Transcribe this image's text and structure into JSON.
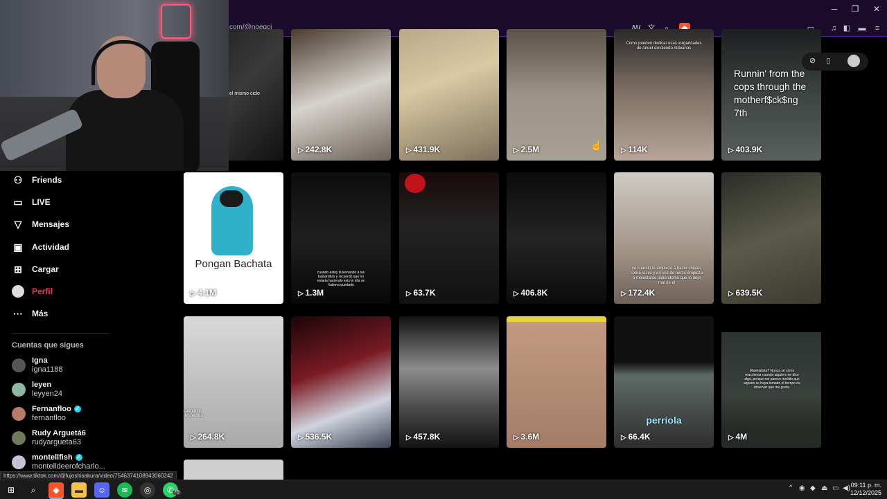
{
  "browser": {
    "url": "com/@noegcj",
    "status_url": "https://www.tiktok.com/@fujoshisakura/video/7546374108943060242"
  },
  "sidebar": {
    "items": [
      {
        "label": "Friends",
        "icon": "friends-icon"
      },
      {
        "label": "LIVE",
        "icon": "live-icon"
      },
      {
        "label": "Mensajes",
        "icon": "messages-icon"
      },
      {
        "label": "Actividad",
        "icon": "activity-icon"
      },
      {
        "label": "Cargar",
        "icon": "upload-icon"
      },
      {
        "label": "Perfil",
        "icon": "profile-avatar"
      },
      {
        "label": "Más",
        "icon": "more-icon"
      }
    ],
    "following_header": "Cuentas que sigues",
    "following": [
      {
        "name": "Igna",
        "user": "igna1188",
        "verified": false
      },
      {
        "name": "leyen",
        "user": "leyyen24",
        "verified": false
      },
      {
        "name": "Fernanfloo",
        "user": "fernanfloo",
        "verified": true
      },
      {
        "name": "Rudy Arguetá6",
        "user": "rudyargueta63",
        "verified": false
      },
      {
        "name": "montellfish",
        "user": "montelldeerofcharlo...",
        "verified": true
      }
    ]
  },
  "videos": [
    {
      "views": "",
      "caption": "el mismo ciclo"
    },
    {
      "views": "242.8K",
      "caption": ""
    },
    {
      "views": "431.9K",
      "caption": ""
    },
    {
      "views": "2.5M",
      "caption": ""
    },
    {
      "views": "114K",
      "caption": "Como pueden dedicar esas vulgaridades de Anuel existiendo Aldeanos"
    },
    {
      "views": "403.9K",
      "caption": "Runnin' from the cops through the motherf$ck$ng 7th"
    },
    {
      "views": "4.1M",
      "caption": "Pongan Bachata"
    },
    {
      "views": "1.3M",
      "caption": "cuando estoy ilusionando a las bastarditas y recuerdo que no estaria haciendo esto si ella se hubiera quedado"
    },
    {
      "views": "63.7K",
      "caption": ""
    },
    {
      "views": "406.8K",
      "caption": ""
    },
    {
      "views": "172.4K",
      "caption": "yo cuando le empiezo a hacer chistes sobre su ex y en vez de reirse empieza a molestarse pidiéndome que lo deje mal de el"
    },
    {
      "views": "639.5K",
      "caption": ""
    },
    {
      "views": "264.8K",
      "caption": "cuentro y despedida"
    },
    {
      "views": "536.5K",
      "caption": ""
    },
    {
      "views": "457.8K",
      "caption": ""
    },
    {
      "views": "3.6M",
      "caption": ""
    },
    {
      "views": "66.4K",
      "caption": "perriola"
    },
    {
      "views": "4M",
      "caption": "Materialista? Nunca sé cómo reaccionar cuando alguien me dice algo, porque me parece insólito que alguien se haya tomado el tiempo de observar que me gusta."
    }
  ],
  "taskbar": {
    "time": "09:11 p. m.",
    "date": "12/12/2025",
    "whatsapp_badge": "70"
  }
}
